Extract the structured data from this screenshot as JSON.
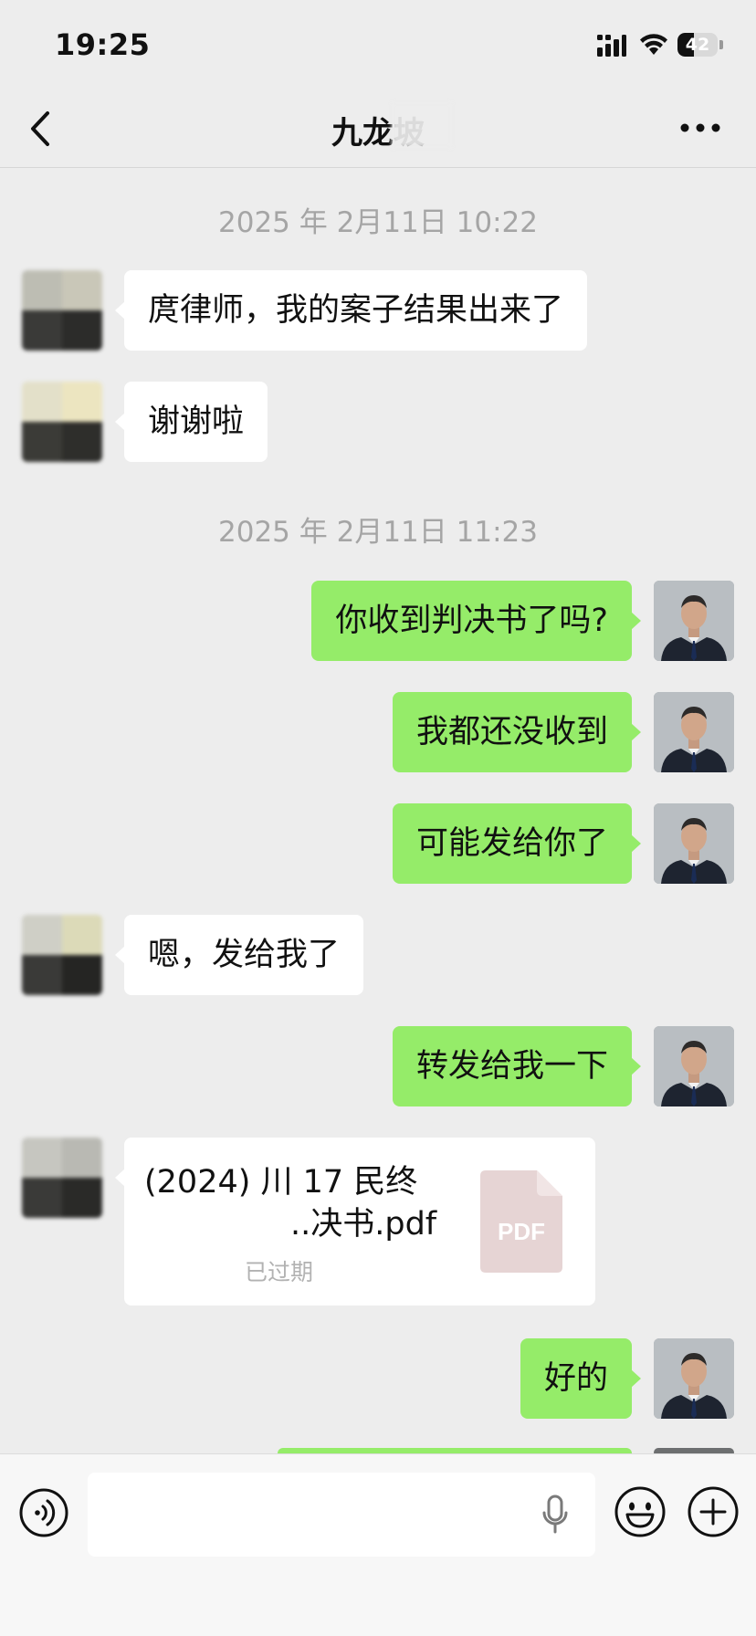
{
  "status_bar": {
    "time": "19:25",
    "battery_level": "42"
  },
  "nav": {
    "title": "九龙坡"
  },
  "messages": [
    {
      "kind": "timestamp",
      "text": "2025 年 2月11日 10:22"
    },
    {
      "kind": "in",
      "text": "庹律师，我的案子结果出来了"
    },
    {
      "kind": "in",
      "text": "谢谢啦"
    },
    {
      "kind": "timestamp",
      "text": "2025 年 2月11日 11:23"
    },
    {
      "kind": "out",
      "text": "你收到判决书了吗?"
    },
    {
      "kind": "out",
      "text": "我都还没收到"
    },
    {
      "kind": "out",
      "text": "可能发给你了"
    },
    {
      "kind": "in",
      "text": "嗯，发给我了"
    },
    {
      "kind": "out",
      "text": "转发给我一下"
    },
    {
      "kind": "out",
      "text": "好的"
    }
  ],
  "file_message": {
    "name_line1": "(2024) 川 17 民终",
    "name_line2": "..决书.pdf",
    "status": "已过期",
    "icon_label": "PDF"
  },
  "colors": {
    "background": "#ededed",
    "outgoing_bubble": "#95ec69",
    "incoming_bubble": "#ffffff",
    "timestamp_text": "#a5a5a5"
  },
  "icons": [
    "back-arrow-icon",
    "more-icon",
    "voice-icon",
    "microphone-icon",
    "emoji-icon",
    "plus-icon",
    "pdf-icon",
    "signal-icon",
    "wifi-icon"
  ]
}
